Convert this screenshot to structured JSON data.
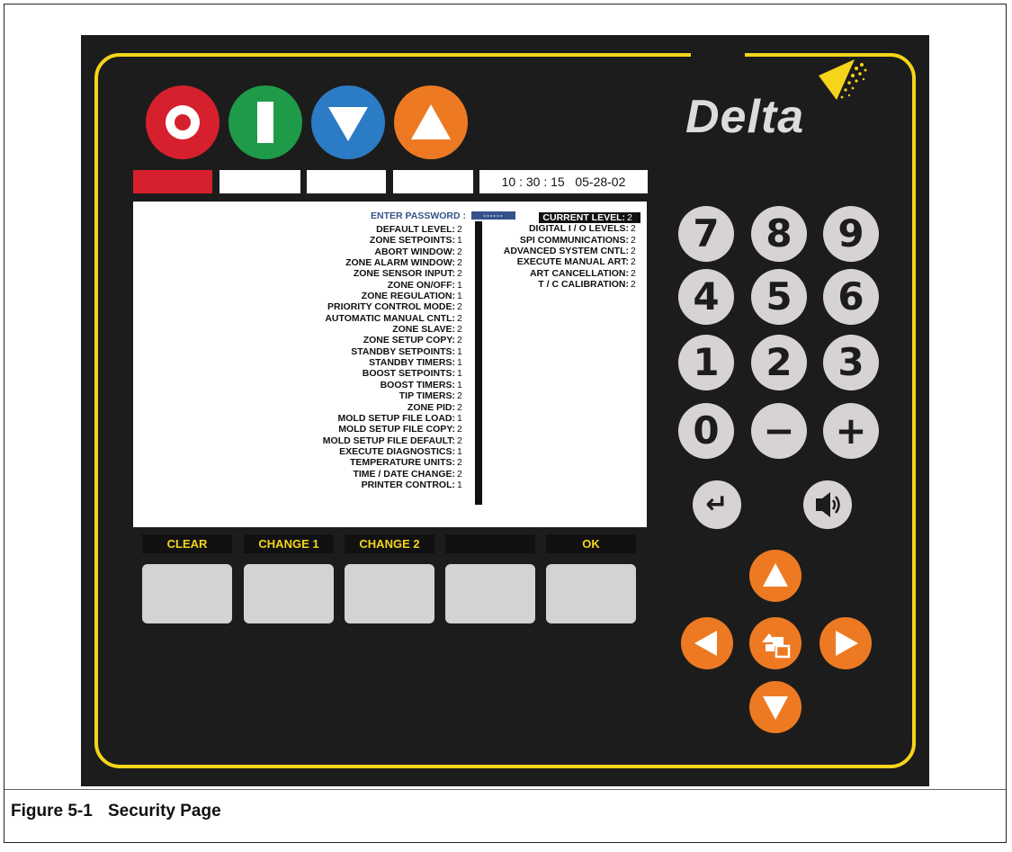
{
  "caption": {
    "figure": "Figure 5-1",
    "title": "Security Page"
  },
  "brand": {
    "logo_text": "Delta"
  },
  "top_buttons": {
    "off": "power-off-icon",
    "on": "power-on-icon",
    "down": "arrow-down-icon",
    "up": "arrow-up-icon"
  },
  "status": {
    "clock": "10 : 30 : 15   05-28-02"
  },
  "password": {
    "label": "ENTER PASSWORD :",
    "value": "------"
  },
  "left_settings": [
    {
      "label": "DEFAULT LEVEL:",
      "value": "2"
    },
    {
      "label": "ZONE SETPOINTS:",
      "value": "1"
    },
    {
      "label": "ABORT WINDOW:",
      "value": "2"
    },
    {
      "label": "ZONE ALARM WINDOW:",
      "value": "2"
    },
    {
      "label": "ZONE SENSOR INPUT:",
      "value": "2"
    },
    {
      "label": "ZONE ON/OFF:",
      "value": "1"
    },
    {
      "label": "ZONE REGULATION:",
      "value": "1"
    },
    {
      "label": "PRIORITY CONTROL MODE:",
      "value": "2"
    },
    {
      "label": "AUTOMATIC MANUAL CNTL:",
      "value": "2"
    },
    {
      "label": "ZONE SLAVE:",
      "value": "2"
    },
    {
      "label": "ZONE SETUP COPY:",
      "value": "2"
    },
    {
      "label": "STANDBY SETPOINTS:",
      "value": "1"
    },
    {
      "label": "STANDBY TIMERS:",
      "value": "1"
    },
    {
      "label": "BOOST SETPOINTS:",
      "value": "1"
    },
    {
      "label": "BOOST TIMERS:",
      "value": "1"
    },
    {
      "label": "TIP TIMERS:",
      "value": "2"
    },
    {
      "label": "ZONE PID:",
      "value": "2"
    },
    {
      "label": "MOLD SETUP FILE LOAD:",
      "value": "1"
    },
    {
      "label": "MOLD SETUP FILE COPY:",
      "value": "2"
    },
    {
      "label": "MOLD SETUP FILE DEFAULT:",
      "value": "2"
    },
    {
      "label": "EXECUTE DIAGNOSTICS:",
      "value": "1"
    },
    {
      "label": "TEMPERATURE UNITS:",
      "value": "2"
    },
    {
      "label": "TIME / DATE CHANGE:",
      "value": "2"
    },
    {
      "label": "PRINTER CONTROL:",
      "value": "1"
    }
  ],
  "current_level": {
    "label": "CURRENT LEVEL:",
    "value": "2"
  },
  "right_settings": [
    {
      "label": "DIGITAL I / O LEVELS:",
      "value": "2"
    },
    {
      "label": "SPI COMMUNICATIONS:",
      "value": "2"
    },
    {
      "label": "ADVANCED SYSTEM CNTL:",
      "value": "2"
    },
    {
      "label": "EXECUTE MANUAL ART:",
      "value": "2"
    },
    {
      "label": "ART CANCELLATION:",
      "value": "2"
    },
    {
      "label": "T / C CALIBRATION:",
      "value": "2"
    }
  ],
  "softkeys": {
    "k1": "CLEAR",
    "k2": "CHANGE 1",
    "k3": "CHANGE 2",
    "k4": "",
    "k5": "OK"
  },
  "keypad": {
    "k7": "7",
    "k8": "8",
    "k9": "9",
    "k4": "4",
    "k5": "5",
    "k6": "6",
    "k1": "1",
    "k2": "2",
    "k3": "3",
    "k0": "0",
    "minus": "−",
    "plus": "+",
    "enter": "↵"
  },
  "colors": {
    "panel": "#1c1c1c",
    "border": "#f4d51a",
    "red": "#d6202e",
    "green": "#1e9a48",
    "blue": "#2c7bc5",
    "orange": "#ed7a22",
    "key": "#d6d3d2",
    "screen_accent": "#34538a"
  }
}
